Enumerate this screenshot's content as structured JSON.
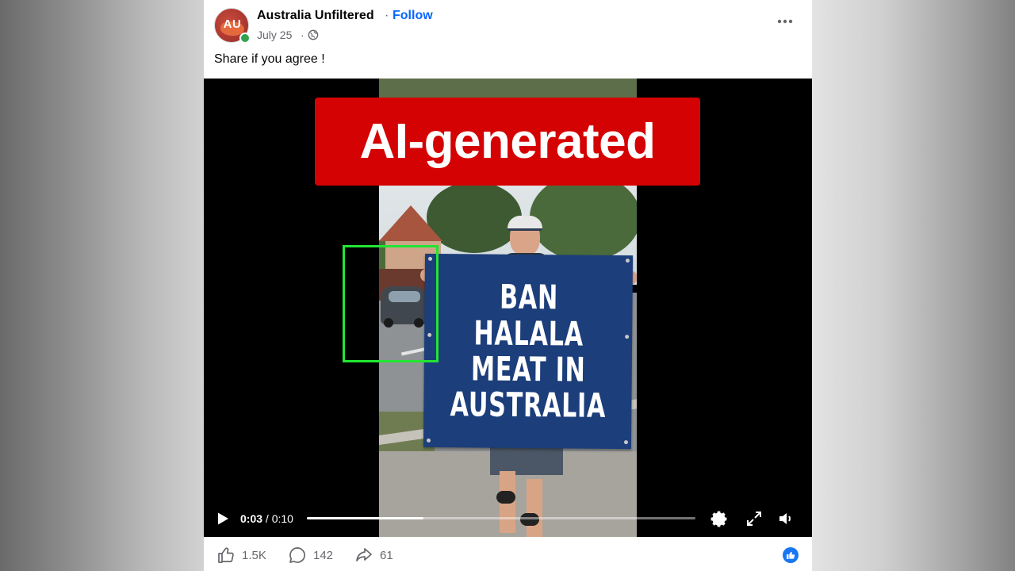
{
  "post": {
    "page_name": "Australia Unfiltered",
    "separator": "·",
    "follow_label": "Follow",
    "date": "July 25",
    "date_separator": "·",
    "avatar_letters": "AU",
    "caption": "Share if you agree !"
  },
  "video": {
    "overlay_label": "AI-generated",
    "banner_lines": [
      "BAN",
      "HALALA",
      "MEAT IN",
      "AUSTRALIA"
    ],
    "current_time": "0:03",
    "time_separator": " / ",
    "duration": "0:10",
    "progress_fraction": 0.3
  },
  "reactions": {
    "likes": "1.5K",
    "comments": "142",
    "shares": "61"
  },
  "colors": {
    "facebook_blue": "#0866ff",
    "label_red": "#d40202",
    "highlight_green": "#22e533",
    "banner_blue": "#1c3e7a"
  },
  "icons": [
    "globe-icon",
    "more-options-icon",
    "play-icon",
    "settings-icon",
    "fullscreen-icon",
    "volume-icon",
    "like-icon",
    "comment-icon",
    "share-icon",
    "like-reaction-icon"
  ]
}
